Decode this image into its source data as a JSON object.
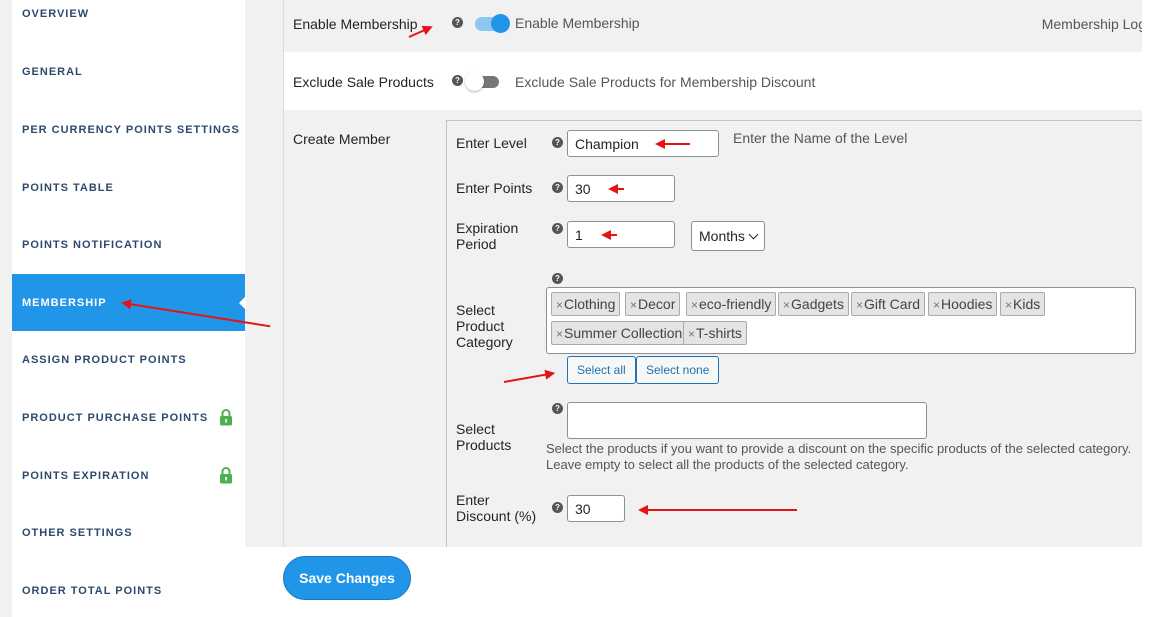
{
  "sidebar": {
    "items": [
      {
        "label": "OVERVIEW"
      },
      {
        "label": "GENERAL"
      },
      {
        "label": "PER CURRENCY POINTS SETTINGS"
      },
      {
        "label": "POINTS TABLE"
      },
      {
        "label": "POINTS NOTIFICATION"
      },
      {
        "label": "MEMBERSHIP",
        "active": true
      },
      {
        "label": "ASSIGN PRODUCT POINTS"
      },
      {
        "label": "PRODUCT PURCHASE POINTS",
        "icon": "lock-icon"
      },
      {
        "label": "POINTS EXPIRATION",
        "icon": "lock-icon"
      },
      {
        "label": "OTHER SETTINGS"
      },
      {
        "label": "ORDER TOTAL POINTS"
      }
    ],
    "active_color": "#2196e9",
    "lock_color": "#4caf50"
  },
  "settings": {
    "enable_membership": {
      "label": "Enable Membership",
      "toggle_label": "Enable Membership",
      "enabled": true,
      "log_link": "Membership Log"
    },
    "exclude_sale": {
      "label": "Exclude Sale Products",
      "toggle_label": "Exclude Sale Products for Membership Discount",
      "enabled": false
    },
    "create_member": {
      "label": "Create Member",
      "level": {
        "label": "Enter Level",
        "value": "Champion",
        "hint": "Enter the Name of the Level"
      },
      "points": {
        "label": "Enter Points",
        "value": "30"
      },
      "expiration": {
        "label_line1": "Expiration",
        "label_line2": "Period",
        "value": "1",
        "unit": "Months"
      },
      "category": {
        "label_line1": "Select",
        "label_line2": "Product",
        "label_line3": "Category",
        "tags": [
          "Clothing",
          "Decor",
          "eco-friendly",
          "Gadgets",
          "Gift Card",
          "Hoodies",
          "Kids",
          "Summer Collection",
          "T-shirts"
        ],
        "select_all": "Select all",
        "select_none": "Select none"
      },
      "products": {
        "label_line1": "Select",
        "label_line2": "Products",
        "value": "",
        "help": "Select the products if you want to provide a discount on the specific products of the selected category. Leave empty to select all the products of the selected category."
      },
      "discount": {
        "label_line1": "Enter",
        "label_line2": "Discount (%)",
        "value": "30"
      }
    }
  },
  "footer": {
    "save_label": "Save Changes"
  },
  "help_glyph": "?",
  "tag_remove_glyph": "×"
}
